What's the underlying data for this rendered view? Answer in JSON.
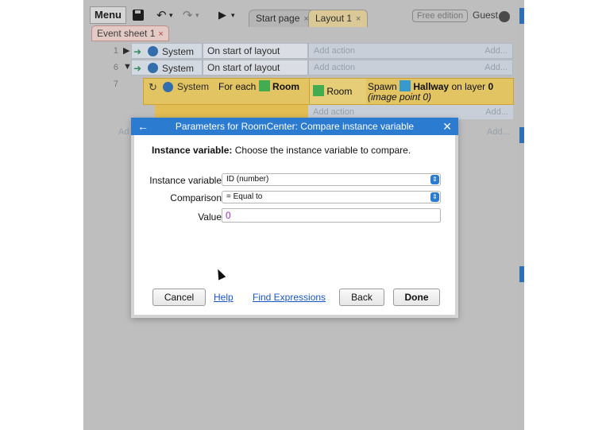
{
  "toolbar": {
    "menu_label": "Menu",
    "undo_glyph": "↶",
    "redo_glyph": "↷",
    "play_glyph": "▶",
    "dropdown_glyph": "▾",
    "tabs": [
      {
        "label": "Start page",
        "close": "×"
      },
      {
        "label": "Layout 1",
        "close": "×"
      }
    ],
    "edition_badge": "Free edition",
    "user_label": "Guest"
  },
  "sheet_tab": {
    "label": "Event sheet 1",
    "close": "×"
  },
  "events": [
    {
      "number": "1",
      "expander": "▶",
      "object": "System",
      "condition": "On start of layout",
      "add_action": "Add action",
      "add_link": "Add..."
    },
    {
      "number": "6",
      "expander": "▼",
      "object": "System",
      "condition": "On start of layout",
      "add_action": "Add action",
      "add_link": "Add..."
    },
    {
      "number": "7",
      "object": "System",
      "condition_prefix": "For each",
      "condition_object": "Room",
      "action_object": "Room",
      "action_text": "Spawn",
      "action_target": "Hallway",
      "action_suffix": "on layer",
      "action_layer": "0",
      "action_detail": "(image point 0)",
      "add_action": "Add action",
      "add_link": "Add..."
    }
  ],
  "side_links": {
    "add_event": "Ad",
    "add_link2": "Add..."
  },
  "dialog": {
    "title": "Parameters for RoomCenter: Compare instance variable",
    "back_glyph": "←",
    "close_glyph": "✕",
    "desc_bold": "Instance variable:",
    "desc_text": " Choose the instance variable to compare.",
    "fields": {
      "instance_variable_label": "Instance variable",
      "instance_variable_value": "ID (number)",
      "comparison_label": "Comparison",
      "comparison_value": "= Equal to",
      "value_label": "Value",
      "value_value": "0"
    },
    "buttons": {
      "cancel": "Cancel",
      "help": "Help",
      "find_expressions": "Find Expressions",
      "back": "Back",
      "done": "Done"
    }
  },
  "colors": {
    "accent": "#2b7bd1",
    "event_highlight": "#f2cf60",
    "object_green": "#3cb34a",
    "object_blue": "#2e9fd8"
  }
}
